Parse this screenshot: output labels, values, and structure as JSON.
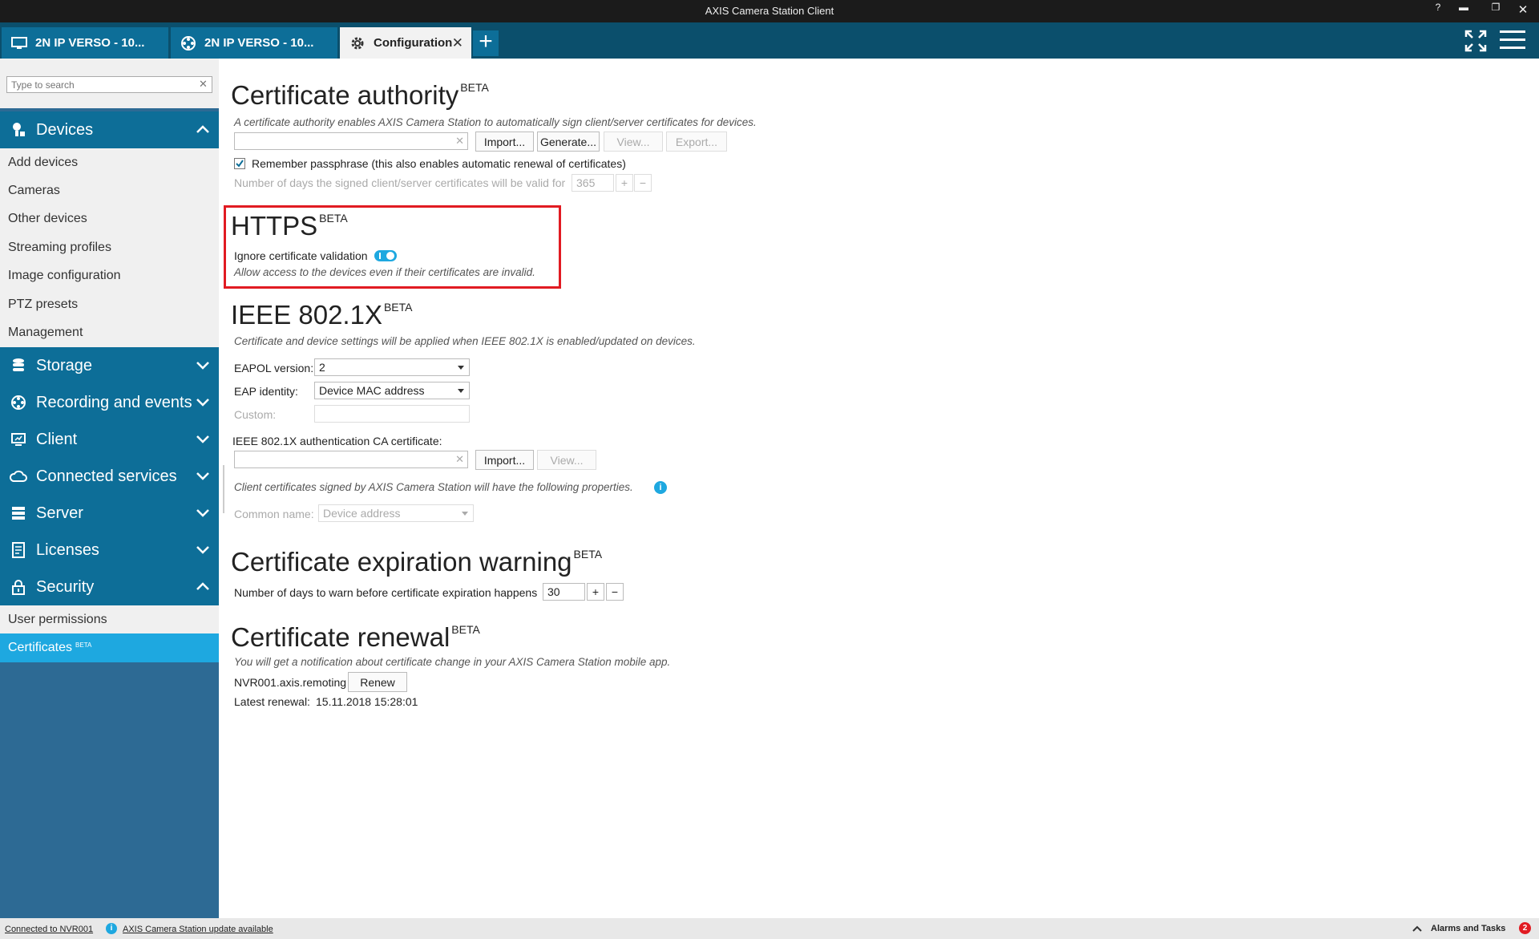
{
  "window": {
    "title": "AXIS Camera Station Client"
  },
  "tabs": [
    {
      "label": "2N IP VERSO - 10..."
    },
    {
      "label": "2N IP VERSO - 10..."
    },
    {
      "label": "Configuration"
    }
  ],
  "sidebar": {
    "search_placeholder": "Type to search",
    "sections": {
      "devices": {
        "label": "Devices",
        "items": [
          "Add devices",
          "Cameras",
          "Other devices",
          "Streaming profiles",
          "Image configuration",
          "PTZ presets",
          "Management"
        ]
      },
      "storage": {
        "label": "Storage"
      },
      "recording": {
        "label": "Recording and events"
      },
      "client": {
        "label": "Client"
      },
      "connected": {
        "label": "Connected services"
      },
      "server": {
        "label": "Server"
      },
      "licenses": {
        "label": "Licenses"
      },
      "security": {
        "label": "Security",
        "items": [
          "User permissions",
          "Certificates"
        ],
        "beta": "BETA"
      }
    }
  },
  "ca": {
    "title": "Certificate authority",
    "beta": "BETA",
    "desc": "A certificate authority enables AXIS Camera Station to automatically sign client/server certificates for devices.",
    "import": "Import...",
    "generate": "Generate...",
    "view": "View...",
    "export": "Export...",
    "remember": "Remember passphrase (this also enables automatic renewal of certificates)",
    "days_label": "Number of days the signed client/server certificates will be valid for",
    "days_value": "365"
  },
  "https": {
    "title": "HTTPS",
    "beta": "BETA",
    "ignore_label": "Ignore certificate validation",
    "ignore_on": true,
    "desc": "Allow access to the devices even if their certificates are invalid."
  },
  "ieee": {
    "title": "IEEE 802.1X",
    "beta": "BETA",
    "desc": "Certificate and device settings will be applied when IEEE 802.1X is enabled/updated on devices.",
    "eapol_label": "EAPOL version:",
    "eapol_value": "2",
    "eap_label": "EAP identity:",
    "eap_value": "Device MAC address",
    "custom_label": "Custom:",
    "ca_label": "IEEE 802.1X authentication CA certificate:",
    "import": "Import...",
    "view": "View...",
    "client_desc": "Client certificates signed by AXIS Camera Station will have the following properties.",
    "cn_label": "Common name:",
    "cn_value": "Device address"
  },
  "expiration": {
    "title": "Certificate expiration warning",
    "beta": "BETA",
    "days_label": "Number of days to warn before certificate expiration happens",
    "days_value": "30"
  },
  "renewal": {
    "title": "Certificate renewal",
    "beta": "BETA",
    "desc": "You will get a notification about certificate change in your AXIS Camera Station mobile app.",
    "host": "NVR001.axis.remoting",
    "renew": "Renew",
    "latest_label": "Latest renewal:",
    "latest_value": "15.11.2018 15:28:01"
  },
  "status": {
    "connected": "Connected to NVR001",
    "update": "AXIS Camera Station update available",
    "alarms": "Alarms and Tasks",
    "alarm_count": "2"
  },
  "colors": {
    "accent": "#1ea8e0",
    "section": "#0d6e98",
    "sidebar": "#2d6a94",
    "highlight": "#e11b22"
  }
}
